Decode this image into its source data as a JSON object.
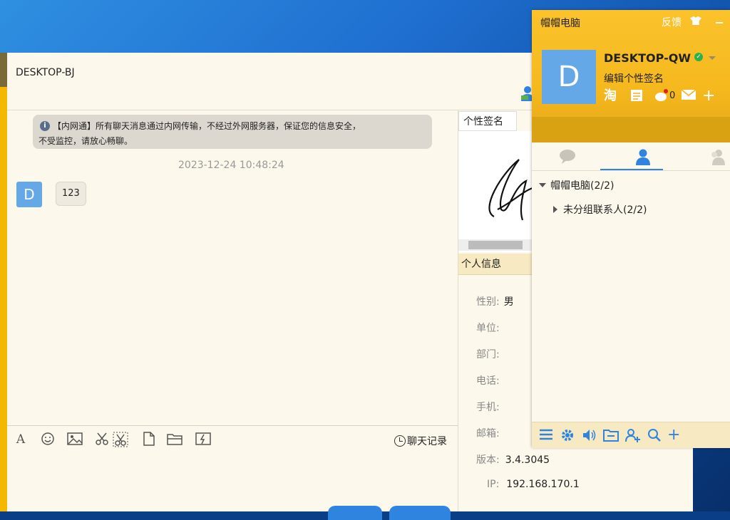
{
  "chat": {
    "title": "DESKTOP-BJ",
    "notice": {
      "line1": "【内网通】所有聊天消息通过内网传输，不经过外网服务器，保证您的信息安全，",
      "line2": "不受监控，请放心畅聊。"
    },
    "timestamp": "2023-12-24 10:48:24",
    "message": {
      "avatar_letter": "D",
      "text": "123"
    },
    "history_label": "聊天记录",
    "toolbar_icons": [
      "font-icon",
      "emoji-icon",
      "image-icon",
      "scissors-icon",
      "screenshot-icon",
      "file-icon",
      "folder-icon",
      "shake-icon"
    ]
  },
  "profile_panel": {
    "signature_tab": "个性签名",
    "info_header": "个人信息",
    "fields": [
      {
        "label": "性别:",
        "value": "男"
      },
      {
        "label": "单位:",
        "value": ""
      },
      {
        "label": "部门:",
        "value": ""
      },
      {
        "label": "电话:",
        "value": ""
      },
      {
        "label": "手机:",
        "value": ""
      },
      {
        "label": "邮箱:",
        "value": ""
      },
      {
        "label": "版本:",
        "value": "3.4.3045"
      },
      {
        "label": "IP:",
        "value": "192.168.170.1"
      }
    ]
  },
  "contacts": {
    "app_title": "帽帽电脑",
    "feedback": "反馈",
    "avatar_letter": "D",
    "user_name": "DESKTOP-QW",
    "signature_prompt": "编辑个性签名",
    "tool_taobao": "淘",
    "notify_count": "0",
    "group_label": "帽帽电脑(2/2)",
    "subgroup_label": "未分组联系人(2/2)"
  },
  "colors": {
    "accent": "#f5b800",
    "avatar": "#64a8e8",
    "link": "#2f84e0",
    "panel_bg": "#fdf8ec"
  }
}
